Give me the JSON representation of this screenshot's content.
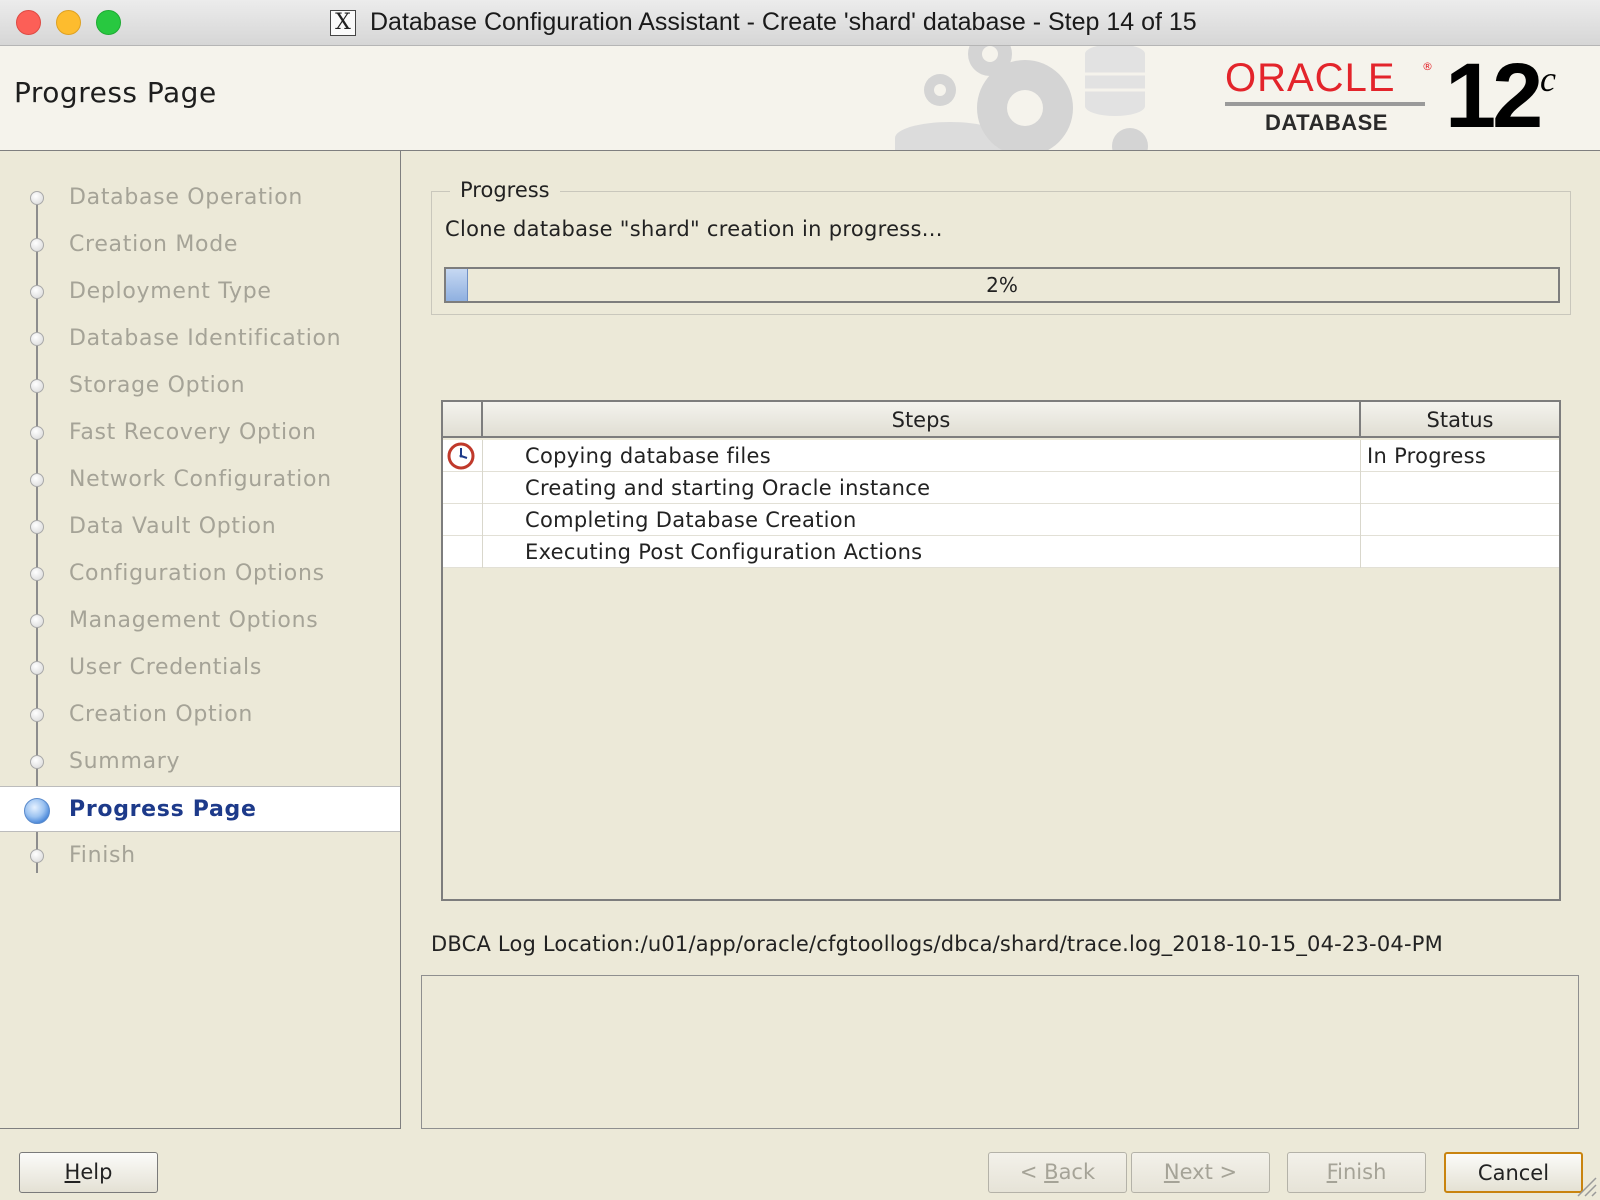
{
  "window": {
    "title": "Database Configuration Assistant - Create 'shard' database - Step 14 of 15",
    "app_icon": "x11-icon",
    "app_icon_glyph": "X"
  },
  "header": {
    "page_title": "Progress Page",
    "brand": {
      "oracle": "ORACLE",
      "reg_mark": "®",
      "database": "DATABASE",
      "version": "12",
      "version_suffix": "c"
    }
  },
  "sidebar": {
    "items": [
      {
        "label": "Database Operation",
        "active": false
      },
      {
        "label": "Creation Mode",
        "active": false
      },
      {
        "label": "Deployment Type",
        "active": false
      },
      {
        "label": "Database Identification",
        "active": false
      },
      {
        "label": "Storage Option",
        "active": false
      },
      {
        "label": "Fast Recovery Option",
        "active": false
      },
      {
        "label": "Network Configuration",
        "active": false
      },
      {
        "label": "Data Vault Option",
        "active": false
      },
      {
        "label": "Configuration Options",
        "active": false
      },
      {
        "label": "Management Options",
        "active": false
      },
      {
        "label": "User Credentials",
        "active": false
      },
      {
        "label": "Creation Option",
        "active": false
      },
      {
        "label": "Summary",
        "active": false
      },
      {
        "label": "Progress Page",
        "active": true
      },
      {
        "label": "Finish",
        "active": false
      }
    ]
  },
  "progress": {
    "group_label": "Progress",
    "message": "Clone database \"shard\" creation in progress...",
    "percent": 2,
    "percent_label": "2%"
  },
  "steps_table": {
    "headers": {
      "icon": "",
      "steps": "Steps",
      "status": "Status"
    },
    "rows": [
      {
        "icon": "clock-icon",
        "step": "Copying database files",
        "status": "In Progress"
      },
      {
        "icon": "",
        "step": "Creating and starting Oracle instance",
        "status": ""
      },
      {
        "icon": "",
        "step": "Completing Database Creation",
        "status": ""
      },
      {
        "icon": "",
        "step": "Executing Post Configuration Actions",
        "status": ""
      }
    ]
  },
  "log": {
    "location": "DBCA Log Location:/u01/app/oracle/cfgtoollogs/dbca/shard/trace.log_2018-10-15_04-23-04-PM",
    "content": ""
  },
  "buttons": {
    "help": {
      "pre": "",
      "mnemonic": "H",
      "post": "elp",
      "enabled": true
    },
    "back": {
      "pre": "< ",
      "mnemonic": "B",
      "post": "ack",
      "enabled": false
    },
    "next": {
      "pre": "",
      "mnemonic": "N",
      "post": "ext >",
      "enabled": false
    },
    "finish": {
      "pre": "",
      "mnemonic": "F",
      "post": "inish",
      "enabled": false
    },
    "cancel": {
      "pre": "",
      "mnemonic": "",
      "post": "Cancel",
      "enabled": true
    }
  },
  "colors": {
    "window_bg": "#ECE9D8",
    "active_step_text": "#1d3a8a",
    "disabled_text": "#a5a397",
    "oracle_red": "#e3242b",
    "progress_fill": "#8fb0e0"
  }
}
